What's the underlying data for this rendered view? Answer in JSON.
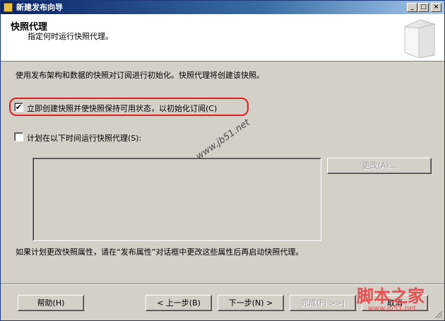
{
  "window": {
    "title": "新建发布向导",
    "minimize": "_",
    "maximize": "□",
    "close": "×"
  },
  "header": {
    "title": "快照代理",
    "subtitle": "指定何时运行快照代理。"
  },
  "body": {
    "description": "使用发布架构和数据的快照对订阅进行初始化。快照代理将创建该快照。",
    "option_immediate": {
      "label": "立即创建快照并使快照保持可用状态，以初始化订阅(C)",
      "checked": true,
      "check_mark": "✔"
    },
    "option_schedule": {
      "label": "计划在以下时间运行快照代理(S):",
      "checked": false
    },
    "schedule_box_text": "",
    "change_button": "更改(A)...",
    "footnote": "如果计划更改快照属性，请在“发布属性”对话框中更改这些属性后再启动快照代理。"
  },
  "buttons": {
    "help": "帮助(H)",
    "back": "< 上一步(B)",
    "next": "下一步(N) >",
    "finish": "完成(F) >>|",
    "cancel": "取消"
  },
  "watermarks": {
    "site": "www.jb51.net",
    "brand": "脚本之家",
    "brand_url": "www.jb51.net"
  },
  "colors": {
    "titlebar_start": "#0a246a",
    "titlebar_end": "#a6caf0",
    "dialog_bg": "#d4d0c8",
    "highlight_ring": "#e02020"
  }
}
